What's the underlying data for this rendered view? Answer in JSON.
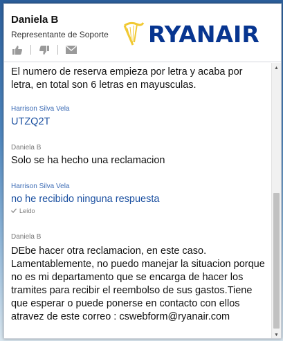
{
  "agent": {
    "name": "Daniela B",
    "role": "Representante de Soporte"
  },
  "header_actions": [
    {
      "icon": "thumbs-up-icon"
    },
    {
      "icon": "thumbs-down-icon"
    },
    {
      "icon": "envelope-icon"
    }
  ],
  "logo": {
    "text": "RYANAIR",
    "color": "#073590",
    "harp_color": "#f1c933"
  },
  "messages": [
    {
      "sender": "",
      "role": "agent",
      "text": "El numero de reserva empieza por letra y acaba por letra, en total son 6 letras en mayusculas."
    },
    {
      "sender": "Harrison Silva Vela",
      "role": "customer",
      "text": "UTZQ2T"
    },
    {
      "sender": "Daniela B",
      "role": "agent",
      "text": "Solo se ha hecho una reclamacion"
    },
    {
      "sender": "Harrison Silva Vela",
      "role": "customer",
      "text": "no he recibido ninguna respuesta",
      "status": "Leído"
    },
    {
      "sender": "Daniela B",
      "role": "agent",
      "text": "DEbe hacer otra reclamacion, en este caso. Lamentablemente, no puedo manejar la situacion porque no es mi departamento que se encarga de hacer los tramites para recibir el reembolso de sus gastos.Tiene que esperar o puede ponerse en contacto con ellos atravez de este correo : cswebform@ryanair.com"
    }
  ],
  "colors": {
    "customer_text": "#1a4fa0",
    "customer_name": "#3a6ab4",
    "agent_text": "#111111"
  }
}
